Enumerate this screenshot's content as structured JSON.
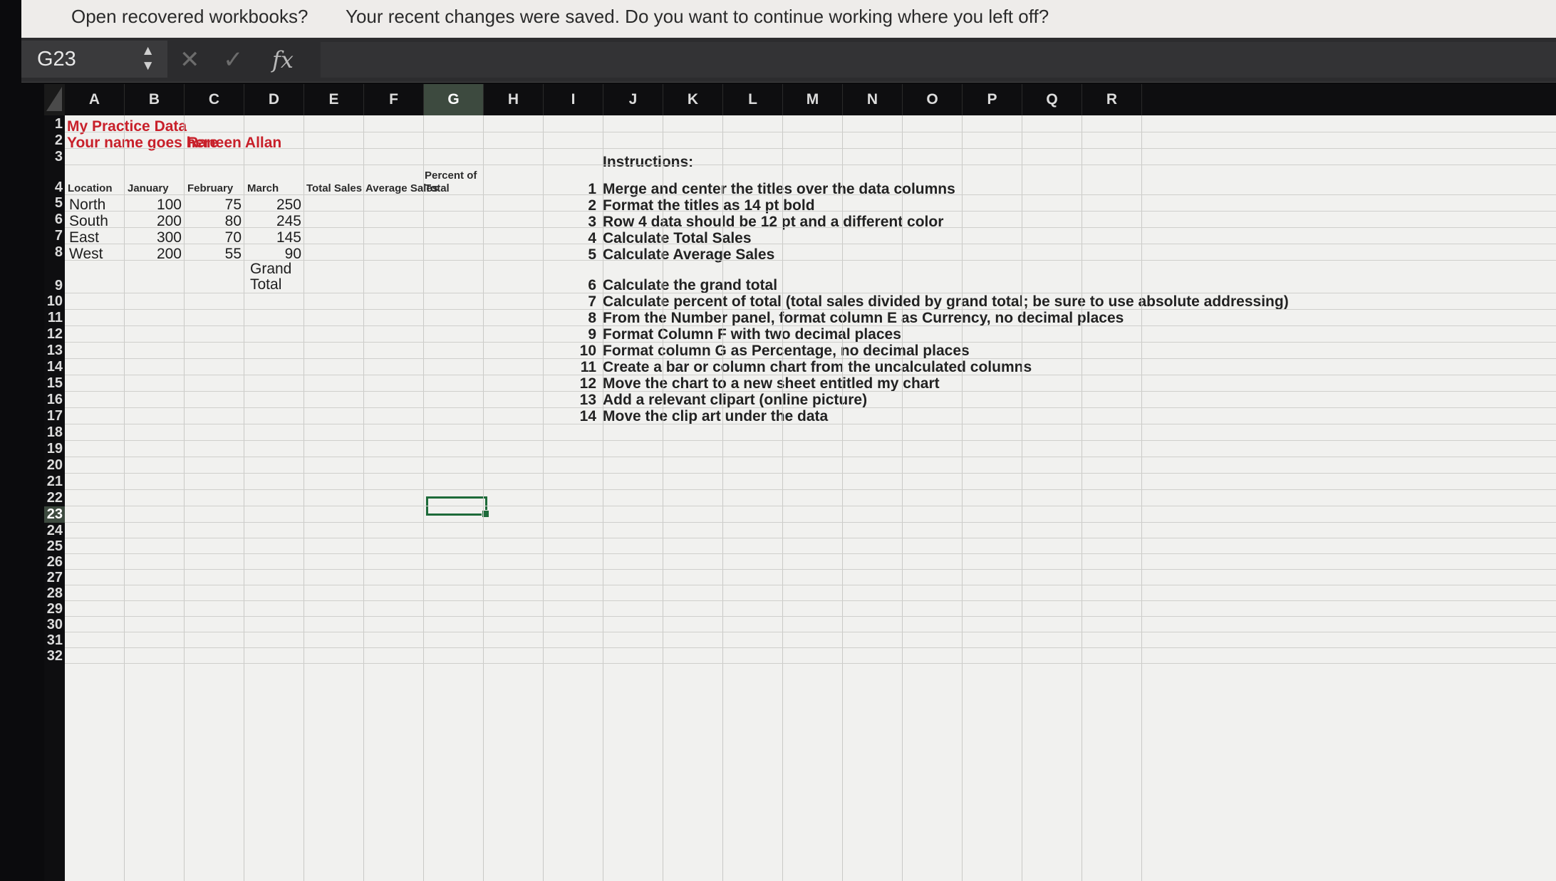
{
  "banner": {
    "question": "Open recovered workbooks?",
    "message": "Your recent changes were saved. Do you want to continue working where you left off?"
  },
  "formula_bar": {
    "name_box": "G23",
    "cancel_icon": "close-icon",
    "enter_icon": "check-icon",
    "fx_label": "fx",
    "formula": ""
  },
  "columns": [
    "A",
    "B",
    "C",
    "D",
    "E",
    "F",
    "G",
    "H",
    "I",
    "J",
    "K",
    "L",
    "M",
    "N",
    "O",
    "P",
    "Q",
    "R"
  ],
  "selected_column": "G",
  "rows": [
    "1",
    "2",
    "3",
    "4",
    "5",
    "6",
    "7",
    "8",
    "9",
    "10",
    "11",
    "12",
    "13",
    "14",
    "15",
    "16",
    "17",
    "18",
    "19",
    "20",
    "21",
    "22",
    "23",
    "24",
    "25",
    "26",
    "27",
    "28",
    "29",
    "30",
    "31",
    "32"
  ],
  "selected_row": "23",
  "sheet": {
    "title": "My Practice Data",
    "name_label": "Your name goes here",
    "name_value": "Raneen Allan",
    "headers": {
      "location": "Location",
      "january": "January",
      "february": "February",
      "march": "March",
      "total_sales": "Total Sales",
      "average_sales": "Average Sales",
      "percent_line1": "Percent of",
      "percent_line2": "Total"
    },
    "data": [
      {
        "location": "North",
        "january": "100",
        "february": "75",
        "march": "250"
      },
      {
        "location": "South",
        "january": "200",
        "february": "80",
        "march": "245"
      },
      {
        "location": "East",
        "january": "300",
        "february": "70",
        "march": "145"
      },
      {
        "location": "West",
        "january": "200",
        "february": "55",
        "march": "90"
      }
    ],
    "grand_total_line1": "Grand",
    "grand_total_line2": "Total"
  },
  "instructions": {
    "heading": "Instructions:",
    "items": [
      {
        "n": "1",
        "text": "Merge and center the titles over the data columns"
      },
      {
        "n": "2",
        "text": "Format the titles as 14 pt bold"
      },
      {
        "n": "3",
        "text": "Row 4 data should be 12 pt and a different color"
      },
      {
        "n": "4",
        "text": "Calculate Total Sales"
      },
      {
        "n": "5",
        "text": "Calculate Average Sales"
      },
      {
        "n": "6",
        "text": "Calculate the grand total"
      },
      {
        "n": "7",
        "text": "Calculate percent of total (total sales divided by grand total; be sure to use absolute addressing)"
      },
      {
        "n": "8",
        "text": "From the Number panel, format column E as Currency, no decimal places"
      },
      {
        "n": "9",
        "text": "Format Column F with two decimal places"
      },
      {
        "n": "10",
        "text": "Format column G as Percentage, no decimal places"
      },
      {
        "n": "11",
        "text": "Create a bar or column chart from the uncalculated columns"
      },
      {
        "n": "12",
        "text": "Move the chart to a new sheet entitled my chart"
      },
      {
        "n": "13",
        "text": "Add a relevant clipart (online picture)"
      },
      {
        "n": "14",
        "text": "Move the clip art under the data"
      }
    ]
  }
}
